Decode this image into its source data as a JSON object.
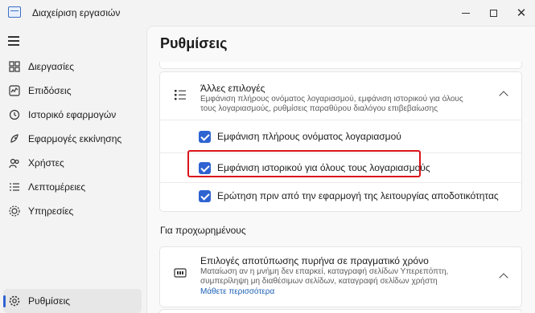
{
  "window": {
    "title": "Διαχείριση εργασιών",
    "controls": {
      "minimize": "",
      "maximize": "",
      "close": "✕"
    }
  },
  "sidebar": {
    "items": [
      {
        "label": "Διεργασίες",
        "icon": "processes-icon",
        "active": false
      },
      {
        "label": "Επιδόσεις",
        "icon": "performance-icon",
        "active": false
      },
      {
        "label": "Ιστορικό εφαρμογών",
        "icon": "history-icon",
        "active": false
      },
      {
        "label": "Εφαρμογές εκκίνησης",
        "icon": "startup-icon",
        "active": false
      },
      {
        "label": "Χρήστες",
        "icon": "users-icon",
        "active": false
      },
      {
        "label": "Λεπτομέρειες",
        "icon": "details-icon",
        "active": false
      },
      {
        "label": "Υπηρεσίες",
        "icon": "services-icon",
        "active": false
      }
    ],
    "settings": {
      "label": "Ρυθμίσεις",
      "icon": "settings-icon",
      "active": true
    }
  },
  "main": {
    "title": "Ρυθμίσεις",
    "other_options": {
      "title": "Άλλες επιλογές",
      "description": "Εμφάνιση πλήρους ονόματος λογαριασμού, εμφάνιση ιστορικού για όλους τους λογαριασμούς, ρυθμίσεις παραθύρου διαλόγου επιβεβαίωσης",
      "checkboxes": [
        {
          "label": "Εμφάνιση πλήρους ονόματος λογαριασμού",
          "checked": true
        },
        {
          "label": "Εμφάνιση ιστορικού για όλους τους λογαριασμούς",
          "checked": true
        },
        {
          "label": "Ερώτηση πριν από την εφαρμογή της λειτουργίας αποδοτικότητας",
          "checked": true
        }
      ]
    },
    "advanced": {
      "section_label": "Για προχωρημένους",
      "title": "Επιλογές αποτύπωσης πυρήνα σε πραγματικό χρόνο",
      "description": "Ματαίωση αν η μνήμη δεν επαρκεί, καταγραφή σελίδων Υπερεπόπτη, συμπερίληψη μη διαθέσιμων σελίδων, καταγραφή σελίδων χρήστη",
      "link": "Μάθετε περισσότερα"
    }
  },
  "colors": {
    "accent": "#2f63d2",
    "highlight": "#d9141b",
    "link": "#1a5fb4"
  }
}
